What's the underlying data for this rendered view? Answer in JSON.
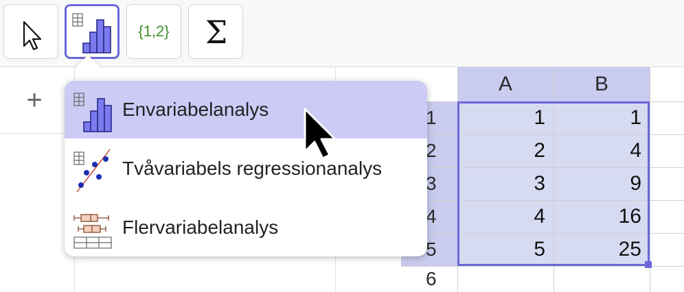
{
  "toolbar": {
    "tools": [
      {
        "name": "move-tool",
        "icon": "pointer-arrow-icon"
      },
      {
        "name": "one-variable-analysis-tool",
        "icon": "histogram-icon",
        "selected": true
      },
      {
        "name": "create-list-tool",
        "icon": "list-braces-icon",
        "label": "{1,2}"
      },
      {
        "name": "sum-tool",
        "icon": "sigma-icon",
        "label": "Σ"
      }
    ]
  },
  "left_panel": {
    "add_label": "+"
  },
  "menu": {
    "items": [
      {
        "label": "Envariabelanalys",
        "icon": "histogram-icon",
        "active": true
      },
      {
        "label": "Tvåvariabels regressionanalys",
        "icon": "scatter-regression-icon"
      },
      {
        "label": "Flervariabelanalys",
        "icon": "boxplot-icon"
      }
    ]
  },
  "spreadsheet": {
    "columns": [
      "A",
      "B"
    ],
    "rows": [
      {
        "header": "1",
        "A": "1",
        "B": "1"
      },
      {
        "header": "2",
        "A": "2",
        "B": "4"
      },
      {
        "header": "3",
        "A": "3",
        "B": "9"
      },
      {
        "header": "4",
        "A": "4",
        "B": "16"
      },
      {
        "header": "5",
        "A": "5",
        "B": "25"
      },
      {
        "header": "6",
        "A": "",
        "B": ""
      }
    ]
  },
  "colors": {
    "accent": "#6c66d9",
    "header_bg": "#c9cbef",
    "selection_bg": "#d7dbf2",
    "menu_active_bg": "#cbcbf6",
    "list_tool_text": "#3f8f2a"
  }
}
